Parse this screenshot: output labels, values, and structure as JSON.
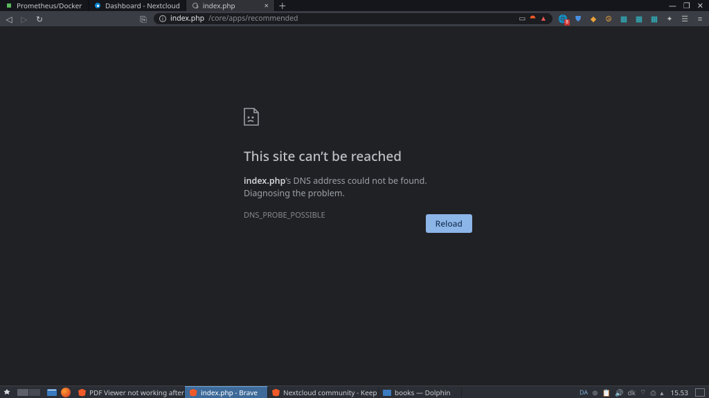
{
  "browser": {
    "tabs": [
      {
        "label": "Prometheus/Docker",
        "favicon": "green-square"
      },
      {
        "label": "Dashboard - Nextcloud",
        "favicon": "nextcloud-circle"
      },
      {
        "label": "index.php",
        "favicon": "globe",
        "active": true
      }
    ],
    "new_tab_glyph": "＋",
    "window_controls": {
      "min": "—",
      "max": "❐",
      "close": "✕"
    }
  },
  "addrbar": {
    "back_glyph": "◁",
    "fwd_glyph": "▷",
    "reload_glyph": "↻",
    "bookmark_glyph": "⎘",
    "info_glyph": "i",
    "url_domain": "index.php",
    "url_rest": "/core/apps/recommended",
    "url_right": {
      "pip": "▭",
      "shield": "⯊",
      "warn": "▲"
    },
    "extensions": [
      {
        "name": "ext-translate",
        "glyph": "🌐",
        "cls": "ext-red tiny-badge-b"
      },
      {
        "name": "ext-bitwarden",
        "glyph": "⛊",
        "cls": "ext-blue"
      },
      {
        "name": "ext-wallet",
        "glyph": "◆",
        "cls": "ext-orange"
      },
      {
        "name": "ext-vscode",
        "glyph": "⧁",
        "cls": "ext-orange"
      },
      {
        "name": "ext-tab1",
        "glyph": "▦",
        "cls": "ext-teal"
      },
      {
        "name": "ext-tab2",
        "glyph": "▦",
        "cls": "ext-teal"
      },
      {
        "name": "ext-tab3",
        "glyph": "▦",
        "cls": "ext-teal"
      },
      {
        "name": "ext-puzzle",
        "glyph": "✦",
        "cls": "ext-gray"
      },
      {
        "name": "ext-list",
        "glyph": "☰",
        "cls": "ext-gray"
      },
      {
        "name": "ext-menu",
        "glyph": "≡",
        "cls": "ext-gray"
      }
    ]
  },
  "error": {
    "title": "This site can’t be reached",
    "host": "index.php",
    "msg_rest": "’s DNS address could not be found. Diagnosing the problem.",
    "code": "DNS_PROBE_POSSIBLE",
    "reload_label": "Reload"
  },
  "taskbar": {
    "tasks": [
      {
        "icon": "brave",
        "label": "PDF Viewer not working after upgr…"
      },
      {
        "icon": "brave",
        "label": "index.php - Brave",
        "active": true
      },
      {
        "icon": "brave",
        "label": "Nextcloud community - Keep your …"
      },
      {
        "icon": "folder",
        "label": "books — Dolphin"
      }
    ],
    "tray": {
      "lang": "DA",
      "ac_glyph": "⊚",
      "clip_glyph": "📋",
      "vol_glyph": "🔊",
      "kb_label": "dk",
      "wifi_glyph": "⌔",
      "print_glyph": "⎙",
      "up_glyph": "▴",
      "clock": "15.53",
      "desk_glyph": ""
    }
  }
}
